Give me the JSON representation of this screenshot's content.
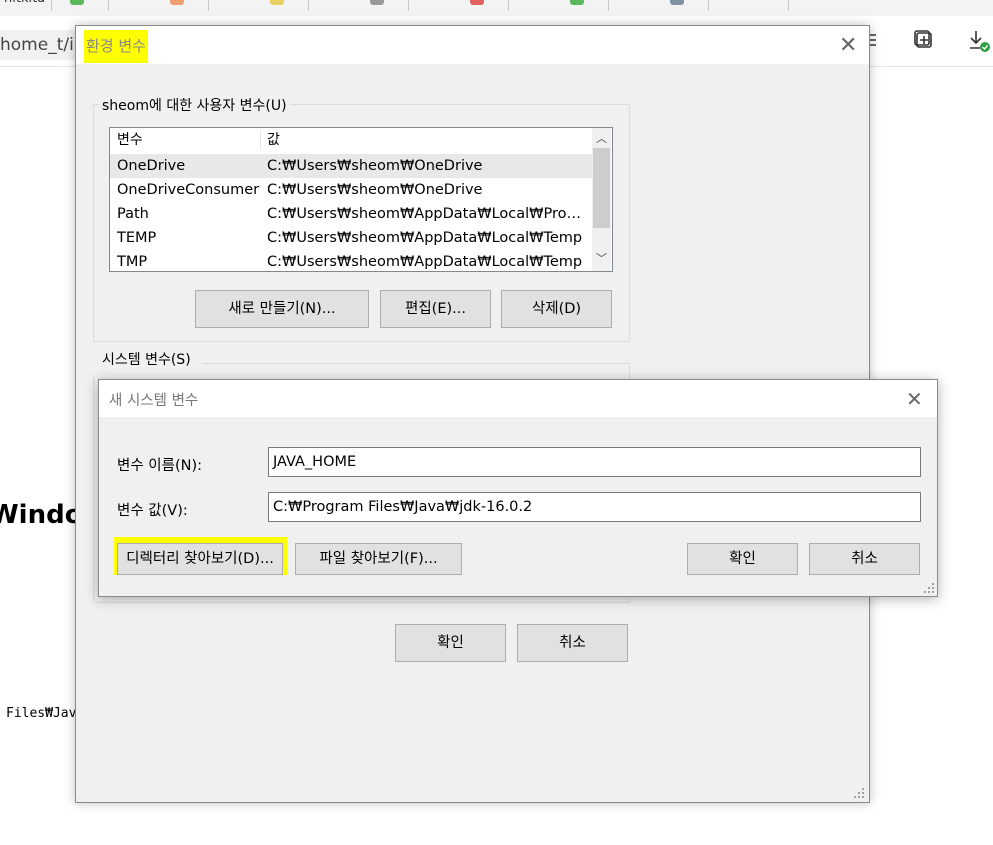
{
  "browser": {
    "url_fragment": "home_t/in"
  },
  "background_page": {
    "heading_fragment": "Window",
    "code_fragment": "Files₩Jav"
  },
  "env_dialog": {
    "title": "환경 변수",
    "user_section_label": "sheom에 대한 사용자 변수(U)",
    "columns": [
      "변수",
      "값"
    ],
    "user_vars": [
      {
        "name": "OneDrive",
        "value": "C:₩Users₩sheom₩OneDrive"
      },
      {
        "name": "OneDriveConsumer",
        "value": "C:₩Users₩sheom₩OneDrive"
      },
      {
        "name": "Path",
        "value": "C:₩Users₩sheom₩AppData₩Local₩Programs..."
      },
      {
        "name": "TEMP",
        "value": "C:₩Users₩sheom₩AppData₩Local₩Temp"
      },
      {
        "name": "TMP",
        "value": "C:₩Users₩sheom₩AppData₩Local₩Temp"
      }
    ],
    "user_buttons": {
      "new": "새로 만들기(N)...",
      "edit": "편집(E)...",
      "delete": "삭제(D)"
    },
    "system_section_label": "시스템 변수(S)",
    "ok": "확인",
    "cancel": "취소"
  },
  "new_var_dialog": {
    "title": "새 시스템 변수",
    "name_label": "변수 이름(N):",
    "name_value": "JAVA_HOME",
    "value_label": "변수 값(V):",
    "value_value": "C:₩Program Files₩Java₩jdk-16.0.2",
    "browse_dir": "디렉터리 찾아보기(D)...",
    "browse_file": "파일 찾아보기(F)...",
    "ok": "확인",
    "cancel": "취소"
  },
  "colors": {
    "highlight": "#ffff00",
    "dialog_bg": "#f0f0f0",
    "button_bg": "#e1e1e1"
  }
}
